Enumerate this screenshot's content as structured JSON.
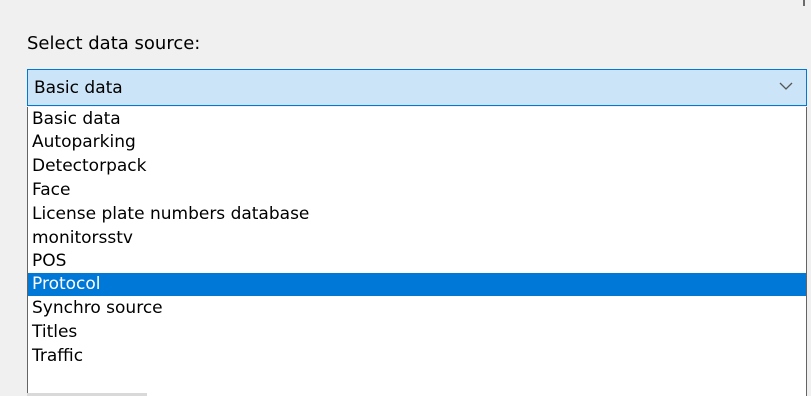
{
  "window": {
    "label_text": "Select data source:"
  },
  "combo": {
    "selected_value": "Basic data",
    "arrow_icon": "chevron-down-icon"
  },
  "dropdown": {
    "options": [
      "Basic data",
      "Autoparking",
      "Detectorpack",
      "Face",
      "License plate numbers database",
      "monitorsstv",
      "POS",
      "Protocol",
      "Synchro source",
      "Titles",
      "Traffic"
    ],
    "highlighted_option": "Protocol"
  },
  "colors": {
    "highlight": "#0078d7",
    "combo_background": "#cce4f7",
    "combo_border": "#0078d7",
    "background": "#f0f0f0"
  }
}
